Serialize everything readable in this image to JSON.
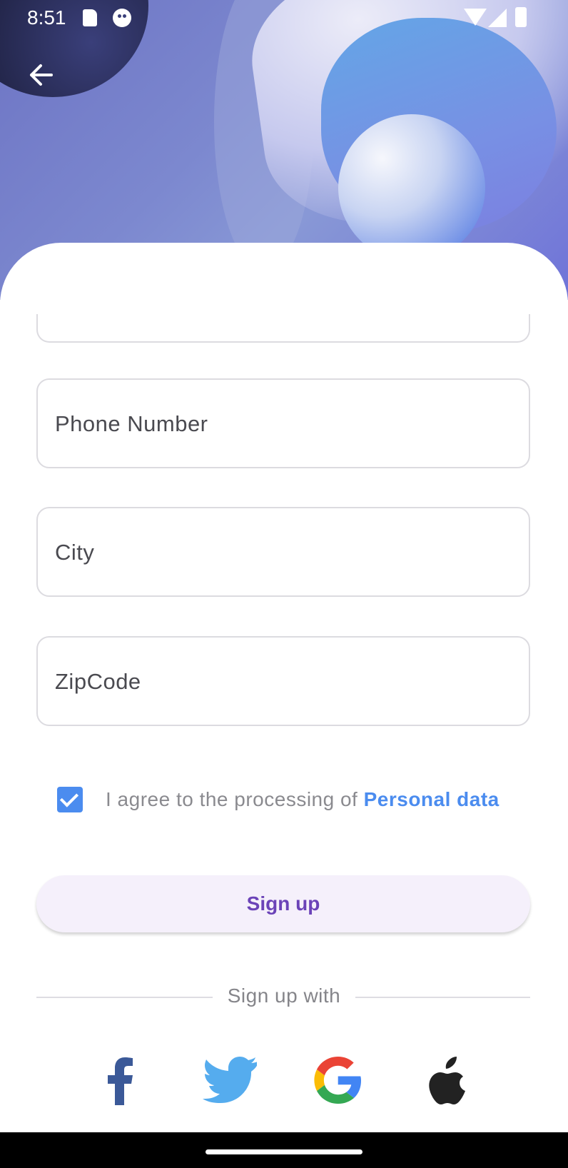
{
  "status_bar": {
    "time": "8:51",
    "icons": [
      "sd-card-icon",
      "cat-icon",
      "wifi-icon",
      "signal-icon",
      "battery-icon"
    ]
  },
  "header": {
    "back_icon": "arrow-back-icon"
  },
  "form": {
    "fields": [
      {
        "placeholder": "Phone Number",
        "value": ""
      },
      {
        "placeholder": "City",
        "value": ""
      },
      {
        "placeholder": "ZipCode",
        "value": ""
      }
    ],
    "agree": {
      "checked": true,
      "text": "I agree to the processing of ",
      "link": "Personal data"
    },
    "signup_label": "Sign up",
    "divider_text": "Sign up with"
  },
  "social": [
    {
      "name": "facebook-icon",
      "color": "#3b5998"
    },
    {
      "name": "twitter-icon",
      "color": "#55acee"
    },
    {
      "name": "google-icon",
      "color": "#4285f4"
    },
    {
      "name": "apple-icon",
      "color": "#222222"
    }
  ],
  "colors": {
    "accent": "#4b8cef",
    "button_text": "#6b43b8",
    "button_bg": "#f5f0fb"
  }
}
